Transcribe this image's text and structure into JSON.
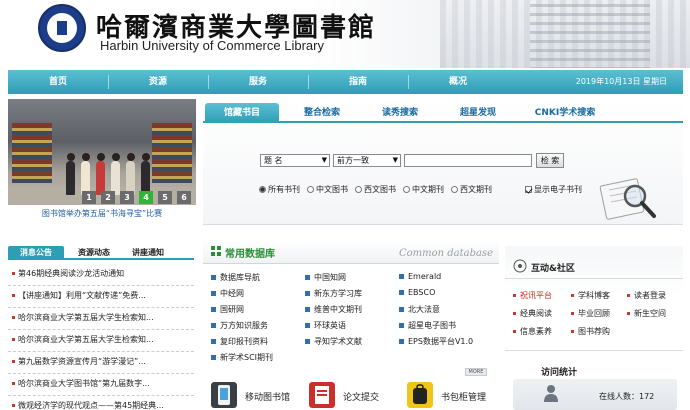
{
  "header": {
    "title_cn": "哈爾濱商業大學圖書館",
    "title_en": "Harbin University of Commerce Library"
  },
  "nav": {
    "items": [
      "首页",
      "资源",
      "服务",
      "指南",
      "概况"
    ],
    "date": "2019年10月13日 星期日"
  },
  "slideshow": {
    "pages": [
      "1",
      "2",
      "3",
      "4",
      "5",
      "6"
    ],
    "active_page": "4",
    "caption": "图书馆举办第五届“书海寻宝”比赛"
  },
  "search": {
    "tabs": [
      "馆藏书目",
      "整合检索",
      "读秀搜索",
      "超星发现",
      "CNKI学术搜索"
    ],
    "active_tab": "馆藏书目",
    "field_select": "题  名",
    "match_select": "前方一致",
    "query": "",
    "button": "检 索",
    "radios": [
      "所有书刊",
      "中文图书",
      "西文图书",
      "中文期刊",
      "西文期刊"
    ],
    "selected_radio": "所有书刊",
    "checkbox_label": "显示电子书刊",
    "checkbox_checked": true
  },
  "notices": {
    "tabs": [
      "消息公告",
      "资源动态",
      "讲座通知"
    ],
    "active_tab": "消息公告",
    "items": [
      "第46期经典阅读沙龙活动通知",
      "【讲座通知】利用“文献传递”免费...",
      "哈尔滨商业大学第五届大学生检索知...",
      "哈尔滨商业大学第五届大学生检索知...",
      "第九届数学资源宣传月“游学漫记”...",
      "哈尔滨商业大学图书馆“第九届数字...",
      "微观经济学的现代观点——第45期经典..."
    ]
  },
  "databases": {
    "title": "常用数据库",
    "title_en": "Common database",
    "col1": [
      "数据库导航",
      "中经网",
      "国研网",
      "万方知识服务",
      "复印报刊资料",
      "新学术SCI期刊"
    ],
    "col2": [
      "中国知网",
      "新东方学习库",
      "维普中文期刊",
      "环球英语",
      "寻知学术文献"
    ],
    "col3": [
      "Emerald",
      "EBSCO",
      "北大法意",
      "超星电子图书",
      "EPS数据平台V1.0"
    ],
    "more": "MORE",
    "services": [
      "移动图书馆",
      "论文提交",
      "书包柜管理"
    ]
  },
  "community": {
    "title": "互动&社区",
    "items": [
      [
        "祝讯平台",
        "学科博客",
        "读者登录"
      ],
      [
        "经典阅读",
        "毕业回顾",
        "新生空间"
      ],
      [
        "信息素养",
        "图书荐购"
      ]
    ],
    "stats_title": "访问统计",
    "online_label": "在线人数：172"
  },
  "colors": {
    "nav": "#2e9db6",
    "link": "#1c5ea8",
    "accent_green": "#2fb536",
    "alert_red": "#d0281e"
  }
}
